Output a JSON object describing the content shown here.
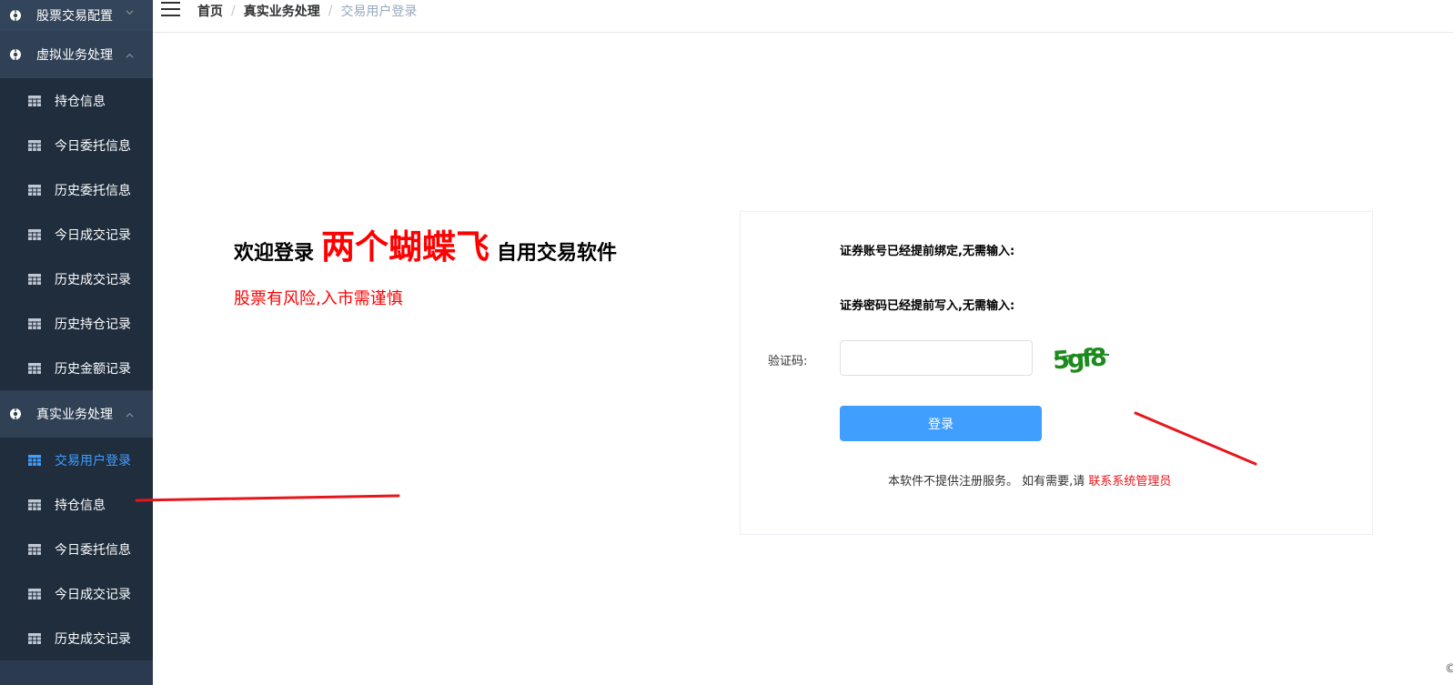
{
  "sidebar": {
    "groups": [
      {
        "label": "股票交易配置",
        "expanded": false
      },
      {
        "label": "虚拟业务处理",
        "expanded": true,
        "items": [
          "持仓信息",
          "今日委托信息",
          "历史委托信息",
          "今日成交记录",
          "历史成交记录",
          "历史持仓记录",
          "历史金额记录"
        ]
      },
      {
        "label": "真实业务处理",
        "expanded": true,
        "items": [
          "交易用户登录",
          "持仓信息",
          "今日委托信息",
          "今日成交记录",
          "历史成交记录"
        ]
      }
    ],
    "active_item": "交易用户登录",
    "active_color": "#409eff"
  },
  "breadcrumb": [
    "首页",
    "真实业务处理",
    "交易用户登录"
  ],
  "welcome": {
    "prefix": "欢迎登录",
    "brand": "两个蝴蝶飞",
    "suffix": "自用交易软件",
    "risk": "股票有风险,入市需谨慎"
  },
  "login": {
    "account_notice": "证券账号已经提前绑定,无需输入:",
    "password_notice": "证券密码已经提前写入,无需输入:",
    "captcha_label": "验证码:",
    "captcha_value": "",
    "captcha_image_text": "5gf8",
    "login_button": "登录",
    "footer_text": "本软件不提供注册服务。 如有需要,请",
    "footer_link": "联系系统管理员"
  },
  "colors": {
    "sidebar_bg": "#1f2d3d",
    "primary": "#409eff",
    "accent_red": "#ff0000"
  }
}
